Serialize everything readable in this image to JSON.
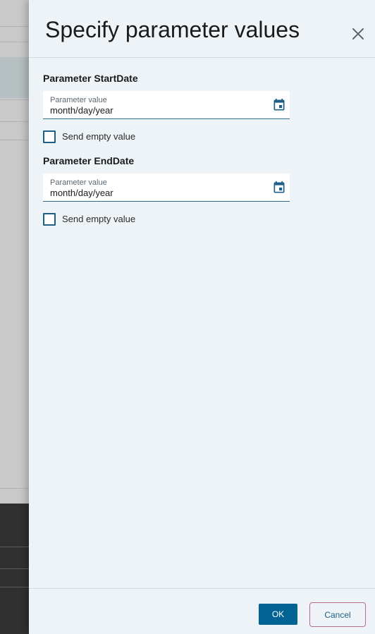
{
  "dialog": {
    "title": "Specify parameter values",
    "close_icon": "close-icon"
  },
  "parameters": [
    {
      "title": "Parameter StartDate",
      "field_label": "Parameter value",
      "value": "month/day/year",
      "calendar_icon": "calendar-icon",
      "send_empty_label": "Send empty value",
      "send_empty_checked": false
    },
    {
      "title": "Parameter EndDate",
      "field_label": "Parameter value",
      "value": "month/day/year",
      "calendar_icon": "calendar-icon",
      "send_empty_label": "Send empty value",
      "send_empty_checked": false
    }
  ],
  "footer": {
    "ok_label": "OK",
    "cancel_label": "Cancel"
  },
  "colors": {
    "panel_background": "#edf3f6",
    "accent": "#006394",
    "checkbox_border": "#1f5f86",
    "cancel_border": "#b56e85"
  }
}
